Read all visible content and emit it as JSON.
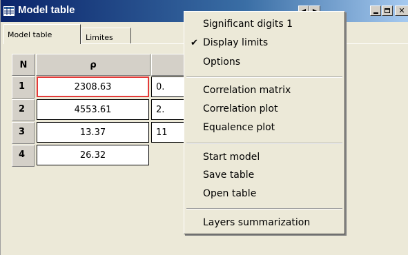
{
  "window": {
    "title": "Model table"
  },
  "tabs": [
    {
      "label": "Model table"
    },
    {
      "label": "Limites"
    }
  ],
  "table": {
    "columns": [
      "N",
      "ρ",
      ""
    ],
    "rows": [
      {
        "n": "1",
        "rho": "2308.63",
        "next": "0."
      },
      {
        "n": "2",
        "rho": "4553.61",
        "next": "2."
      },
      {
        "n": "3",
        "rho": "13.37",
        "next": "11"
      },
      {
        "n": "4",
        "rho": "26.32",
        "next": ""
      }
    ]
  },
  "context_menu": {
    "groups": [
      [
        {
          "label": "Significant digits 1",
          "checked": false
        },
        {
          "label": "Display limits",
          "checked": true
        },
        {
          "label": "Options",
          "checked": false
        }
      ],
      [
        {
          "label": "Correlation matrix"
        },
        {
          "label": "Correlation plot"
        },
        {
          "label": "Equalence plot"
        }
      ],
      [
        {
          "label": "Start model"
        },
        {
          "label": "Save table"
        },
        {
          "label": "Open table"
        }
      ],
      [
        {
          "label": "Layers summarization"
        }
      ]
    ],
    "check_glyph": "✔"
  },
  "colors": {
    "selected_cell_border": "#e43a3a",
    "title_bar": "#0a246a"
  },
  "icons": [
    "table-icon",
    "scroll-left-icon",
    "scroll-right-icon",
    "minimize-icon",
    "maximize-icon",
    "close-icon"
  ]
}
